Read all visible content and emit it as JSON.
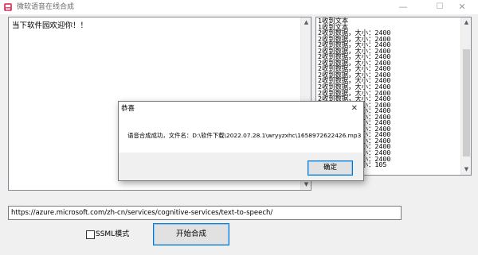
{
  "window": {
    "title": "微软语音在线合成",
    "app_icon": "app-logo-icon",
    "minimize_glyph": "—",
    "maximize_glyph": "☐",
    "close_glyph": "✕"
  },
  "input_text": "当下软件园欢迎你！！",
  "log_lines": [
    "1收到文本",
    "1收到文本",
    "2收到数据，大小：2400",
    "2收到数据，大小：2400",
    "2收到数据，大小：2400",
    "2收到数据，大小：2400",
    "2收到数据，大小：2400",
    "2收到数据，大小：2400",
    "2收到数据，大小：2400",
    "2收到数据，大小：2400",
    "2收到数据，大小：2400",
    "2收到数据，大小：2400",
    "2收到数据，大小：2400",
    "2收到数据，大小：2400",
    "2收到数据，大小：2400",
    "2收到数据，大小：2400",
    "2收到数据，大小：2400",
    "2收到数据，大小：2400",
    "2收到数据，大小：2400",
    "2收到数据，大小：2400",
    "2收到数据，大小：2400",
    "2收到数据，大小：2400",
    "2收到数据，大小：2400",
    "2收到数据，大小：2400",
    "2收到数据，大小：105"
  ],
  "url": "https://azure.microsoft.com/zh-cn/services/cognitive-services/text-to-speech/",
  "ssml_checkbox": {
    "label": "SSML模式",
    "checked": false
  },
  "start_button": "开始合成",
  "dialog": {
    "title": "恭喜",
    "message": "语音合成成功，文件名：D:\\软件下载\\2022.07.28.1\\wryyzxhc\\1658972622426.mp3",
    "ok_label": "确定",
    "close_glyph": "✕"
  },
  "scroll": {
    "up_glyph": "▲",
    "down_glyph": "▼"
  },
  "colors": {
    "accent": "#0078d7",
    "window_bg": "#f0f0f0",
    "field_border": "#828790"
  }
}
